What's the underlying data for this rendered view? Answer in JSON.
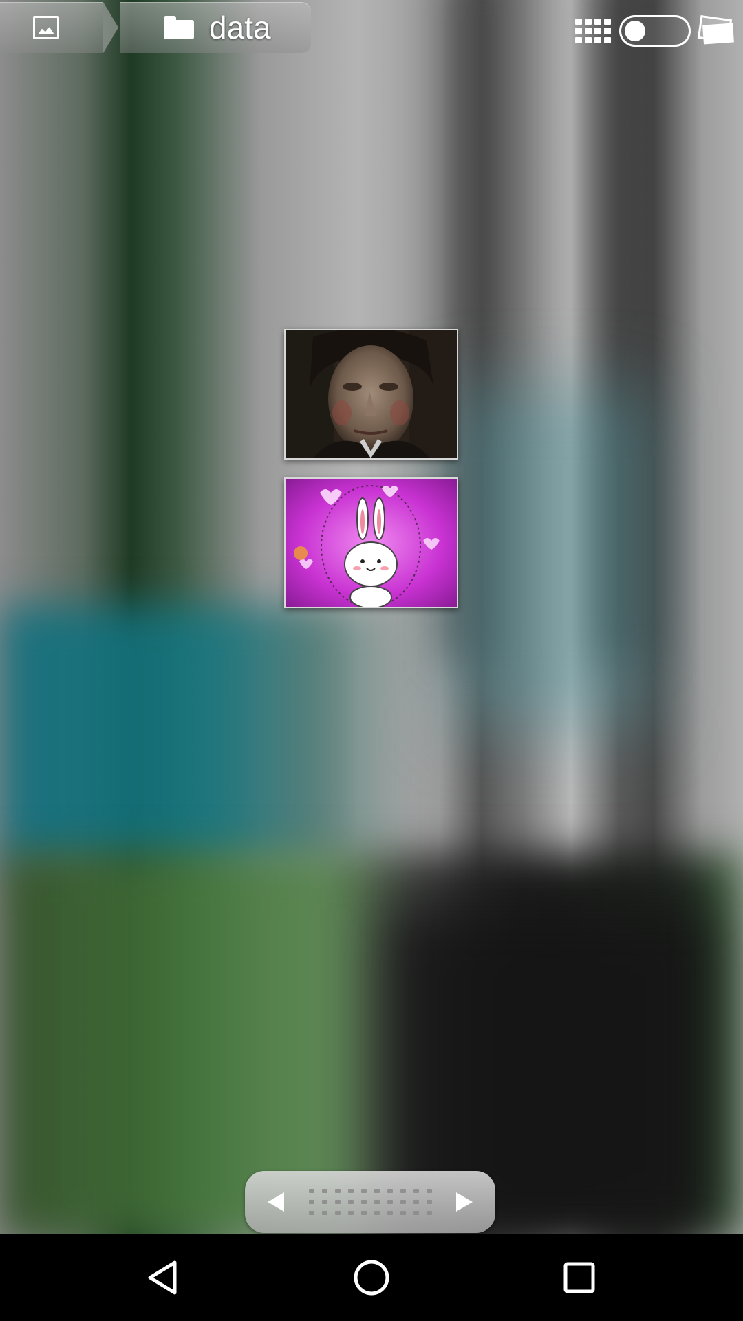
{
  "breadcrumb": {
    "home_icon": "gallery-icon",
    "folder_icon": "folder-icon",
    "current_folder": "data"
  },
  "toolbar": {
    "grid_view_icon": "grid-view-icon",
    "view_toggle": {
      "state": "off"
    },
    "slideshow_icon": "slideshow-icon"
  },
  "thumbnails": [
    {
      "subject": "man-portrait"
    },
    {
      "subject": "pink-bunny-cartoon"
    }
  ],
  "pager": {
    "prev_icon": "triangle-left",
    "next_icon": "triangle-right"
  },
  "navbar": {
    "back": "back-icon",
    "home": "home-icon",
    "recent": "recent-apps-icon"
  },
  "colors": {
    "nav_bar": "#000000",
    "toolbar_icons": "#ffffff",
    "bunny_background": "#c832d2"
  }
}
